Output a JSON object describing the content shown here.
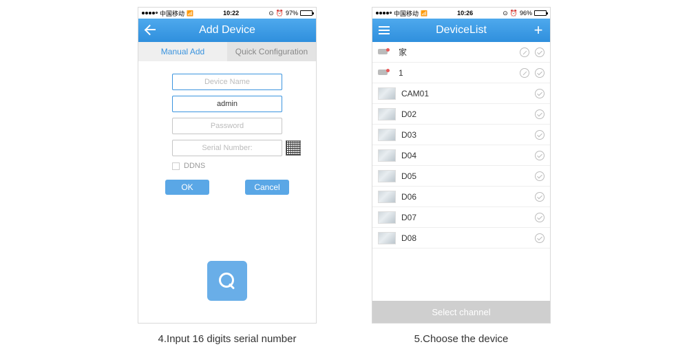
{
  "phone1": {
    "status": {
      "carrier": "中国移动",
      "time": "10:22",
      "battery_pct": "97%"
    },
    "nav": {
      "title": "Add Device"
    },
    "tabs": {
      "manual": "Manual Add",
      "quick": "Quick Configuration"
    },
    "form": {
      "device_name_ph": "Device Name",
      "username_value": "admin",
      "password_ph": "Password",
      "serial_ph": "Serial Number:",
      "ddns_label": "DDNS"
    },
    "buttons": {
      "ok": "OK",
      "cancel": "Cancel"
    },
    "caption": "4.Input 16 digits serial number"
  },
  "phone2": {
    "status": {
      "carrier": "中国移动",
      "time": "10:26",
      "battery_pct": "96%"
    },
    "nav": {
      "title": "DeviceList"
    },
    "groups": [
      {
        "name": "家",
        "editable": true
      },
      {
        "name": "1",
        "editable": true
      }
    ],
    "channels": [
      {
        "name": "CAM01"
      },
      {
        "name": "D02"
      },
      {
        "name": "D03"
      },
      {
        "name": "D04"
      },
      {
        "name": "D05"
      },
      {
        "name": "D06"
      },
      {
        "name": "D07"
      },
      {
        "name": "D08"
      }
    ],
    "select_label": "Select channel",
    "caption": "5.Choose the device"
  }
}
